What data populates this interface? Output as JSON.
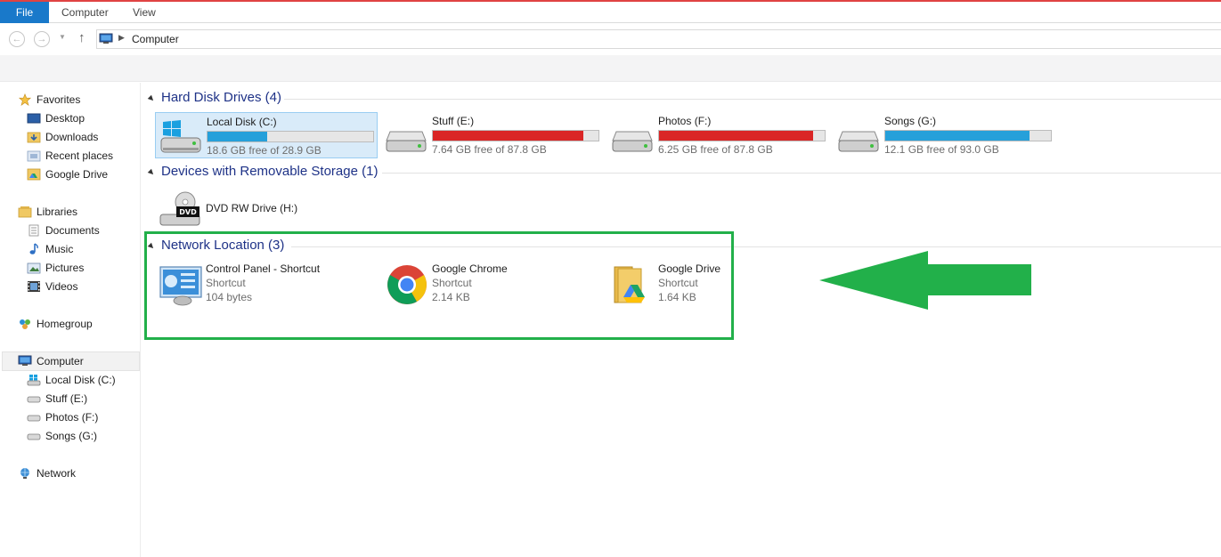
{
  "ribbon": {
    "tabs": [
      {
        "label": "File"
      },
      {
        "label": "Computer"
      },
      {
        "label": "View"
      }
    ]
  },
  "address": {
    "path": "Computer"
  },
  "nav_pane": {
    "favorites": {
      "label": "Favorites",
      "items": [
        "Desktop",
        "Downloads",
        "Recent places",
        "Google Drive"
      ]
    },
    "libraries": {
      "label": "Libraries",
      "items": [
        "Documents",
        "Music",
        "Pictures",
        "Videos"
      ]
    },
    "homegroup": {
      "label": "Homegroup"
    },
    "computer": {
      "label": "Computer",
      "items": [
        "Local Disk (C:)",
        "Stuff (E:)",
        "Photos (F:)",
        "Songs (G:)"
      ]
    },
    "network": {
      "label": "Network"
    }
  },
  "content": {
    "hard_disks": {
      "title": "Hard Disk Drives (4)",
      "drives": [
        {
          "name": "Local Disk (C:)",
          "free": "18.6 GB free of 28.9 GB",
          "used_fraction": 0.36,
          "bar_color": "#26a0da"
        },
        {
          "name": "Stuff (E:)",
          "free": "7.64 GB free of 87.8 GB",
          "used_fraction": 0.91,
          "bar_color": "#da2626"
        },
        {
          "name": "Photos (F:)",
          "free": "6.25 GB free of 87.8 GB",
          "used_fraction": 0.93,
          "bar_color": "#da2626"
        },
        {
          "name": "Songs (G:)",
          "free": "12.1 GB free of 93.0 GB",
          "used_fraction": 0.87,
          "bar_color": "#26a0da"
        }
      ]
    },
    "removable": {
      "title": "Devices with Removable Storage (1)",
      "devices": [
        {
          "name": "DVD RW Drive (H:)",
          "icon": "dvd-drive-icon",
          "badge": "DVD"
        }
      ]
    },
    "network_locations": {
      "title": "Network Location (3)",
      "items": [
        {
          "name": "Control Panel - Shortcut",
          "type": "Shortcut",
          "size": "104 bytes",
          "icon": "control-panel-icon"
        },
        {
          "name": "Google Chrome",
          "type": "Shortcut",
          "size": "2.14 KB",
          "icon": "chrome-icon"
        },
        {
          "name": "Google Drive",
          "type": "Shortcut",
          "size": "1.64 KB",
          "icon": "google-drive-folder-icon"
        }
      ]
    }
  },
  "annotation": {
    "highlight_color": "#22b04a",
    "arrow_color": "#22b04a"
  }
}
